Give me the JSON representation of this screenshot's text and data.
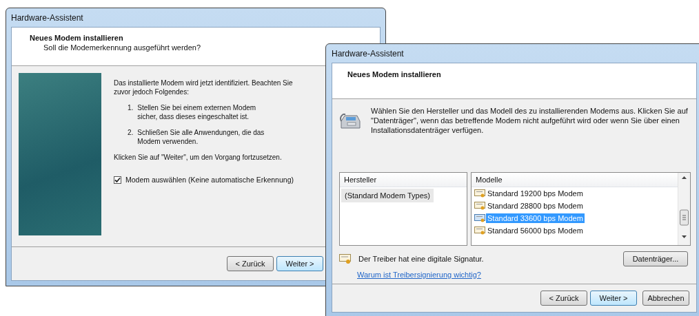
{
  "back_window": {
    "title": "Hardware-Assistent",
    "heading": "Neues Modem installieren",
    "subheading": "Soll die Modemerkennung ausgeführt werden?",
    "intro": "Das installierte Modem wird jetzt identifiziert. Beachten Sie zuvor jedoch Folgendes:",
    "steps": [
      {
        "number": "1.",
        "text": "Stellen Sie bei einem externen Modem sicher, dass dieses eingeschaltet ist."
      },
      {
        "number": "2.",
        "text": "Schließen Sie alle Anwendungen, die das Modem verwenden."
      }
    ],
    "note": "Klicken Sie auf \"Weiter\", um den Vorgang fortzusetzen.",
    "checkbox": {
      "label": "Modem auswählen (Keine automatische Erkennung)",
      "checked": true
    },
    "buttons": [
      {
        "label": "< Zurück",
        "default": false
      },
      {
        "label": "Weiter >",
        "default": true
      }
    ]
  },
  "front_window": {
    "title": "Hardware-Assistent",
    "heading": "Neues Modem installieren",
    "intro": "Wählen Sie den Hersteller und das Modell des zu installierenden Modems aus. Klicken Sie auf \"Datenträger\", wenn das betreffende Modem nicht aufgeführt wird oder wenn Sie über einen Installationsdatenträger verfügen.",
    "manufacturers": {
      "header": "Hersteller",
      "items": [
        {
          "label": "(Standard Modem Types)",
          "selected": true
        }
      ]
    },
    "models": {
      "header": "Modelle",
      "items": [
        {
          "label": "Standard 19200 bps Modem",
          "selected": false
        },
        {
          "label": "Standard 28800 bps Modem",
          "selected": false
        },
        {
          "label": "Standard 33600 bps Modem",
          "selected": true
        },
        {
          "label": "Standard 56000 bps Modem",
          "selected": false
        }
      ]
    },
    "signature": "Der Treiber hat eine digitale Signatur.",
    "link": "Warum ist Treibersignierung wichtig?",
    "disk_button": "Datenträger...",
    "buttons": [
      {
        "label": "< Zurück",
        "default": false
      },
      {
        "label": "Weiter >",
        "default": true
      },
      {
        "label": "Abbrechen",
        "default": false
      }
    ]
  }
}
